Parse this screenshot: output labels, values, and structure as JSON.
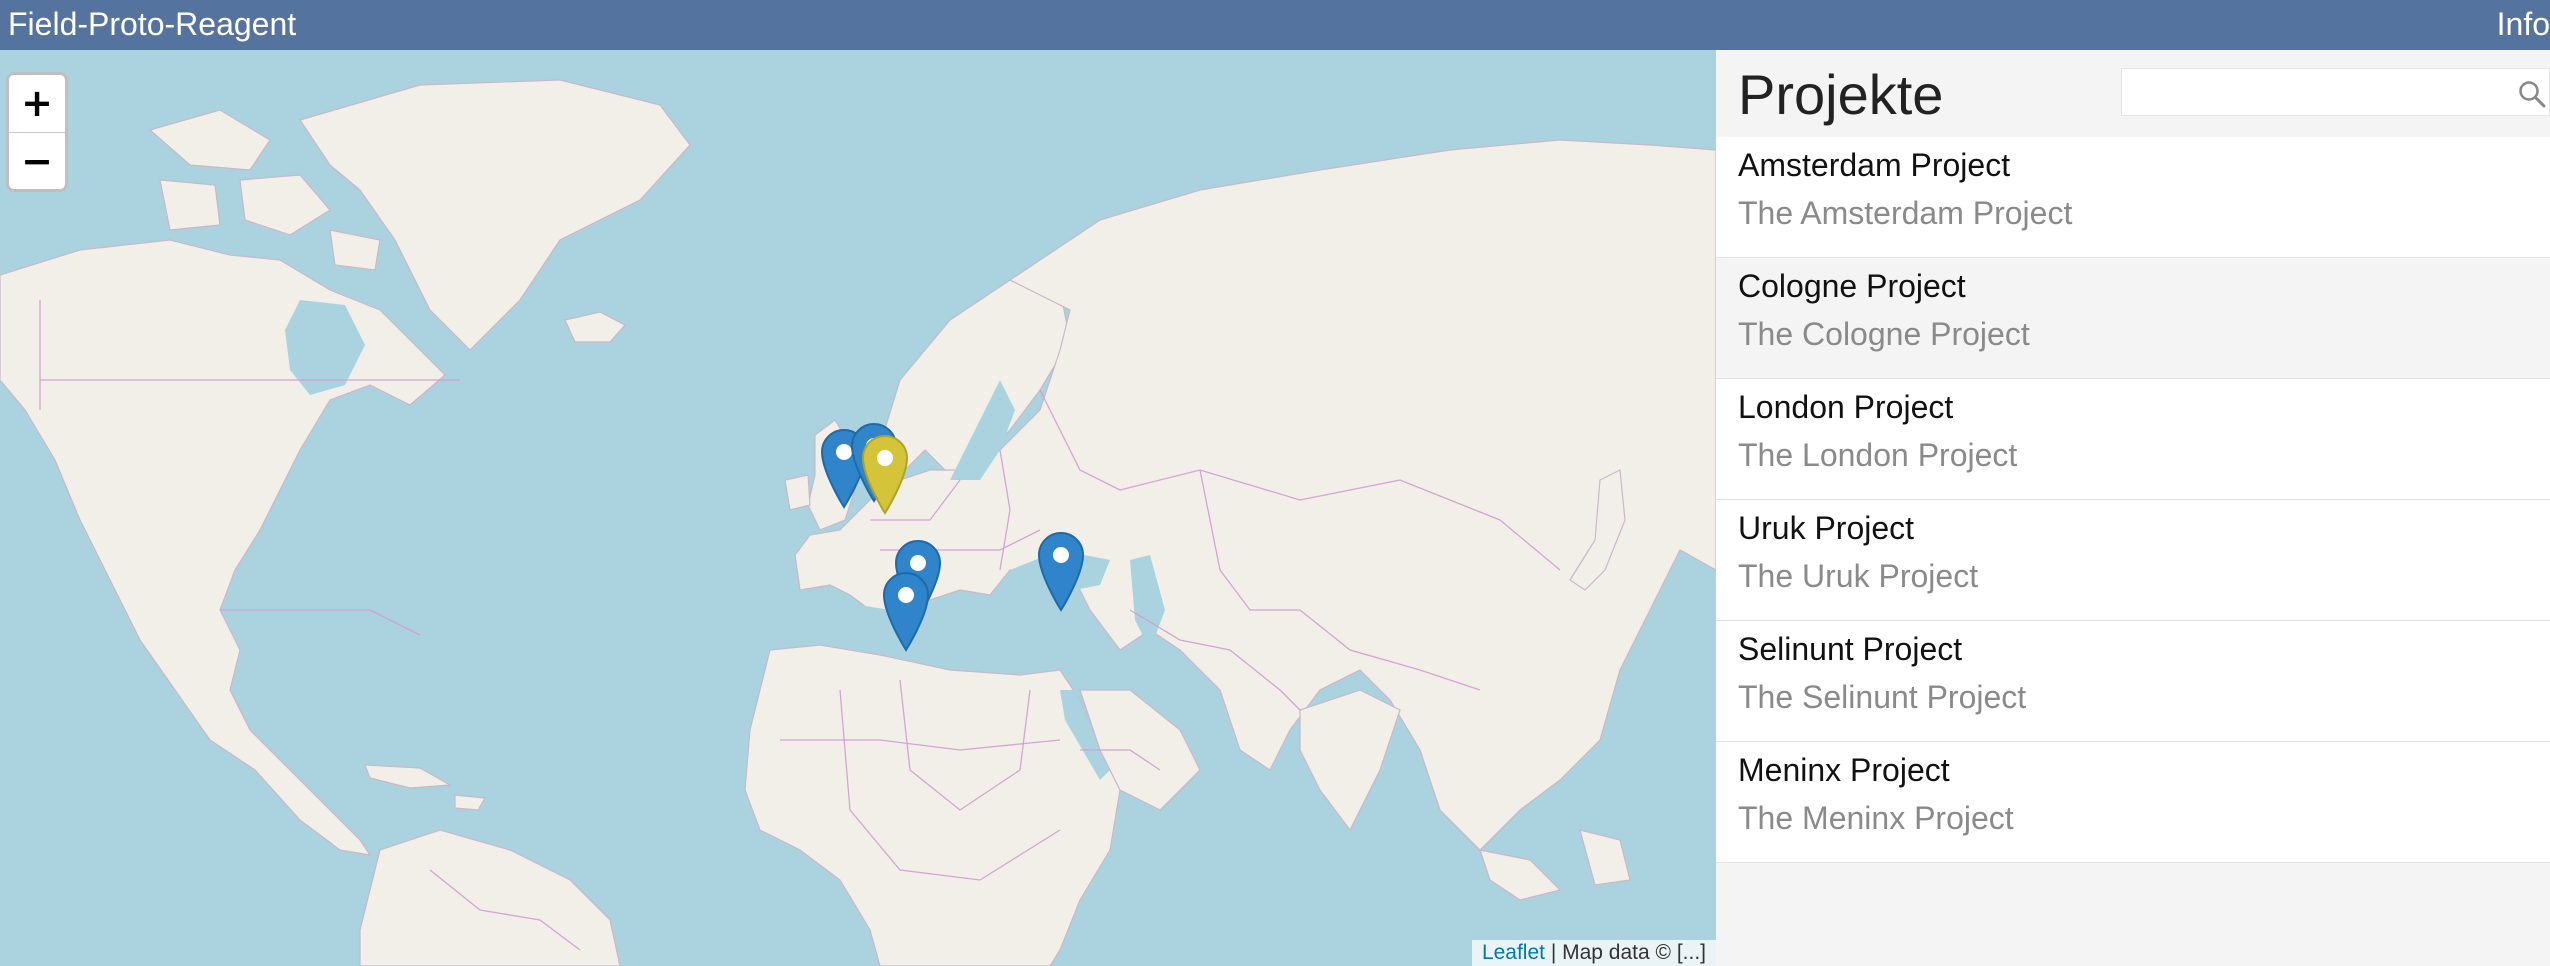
{
  "app": {
    "title": "Field-Proto-Reagent",
    "info_label": "Info"
  },
  "map": {
    "zoom_in_label": "+",
    "zoom_out_label": "−",
    "attribution_link": "Leaflet",
    "attribution_text": " | Map data © [...]",
    "colors": {
      "water": "#aad3df",
      "land": "#f2efe9",
      "border": "#cf9ccf",
      "marker": "#2f84ca",
      "marker_selected": "#d3c43a"
    }
  },
  "sidebar": {
    "title": "Projekte",
    "search": {
      "value": "",
      "placeholder": ""
    },
    "projects": [
      {
        "name": "Amsterdam Project",
        "description": "The Amsterdam Project"
      },
      {
        "name": "Cologne Project",
        "description": "The Cologne Project"
      },
      {
        "name": "London Project",
        "description": "The London Project"
      },
      {
        "name": "Uruk Project",
        "description": "The Uruk Project"
      },
      {
        "name": "Selinunt Project",
        "description": "The Selinunt Project"
      },
      {
        "name": "Meninx Project",
        "description": "The Meninx Project"
      }
    ]
  }
}
